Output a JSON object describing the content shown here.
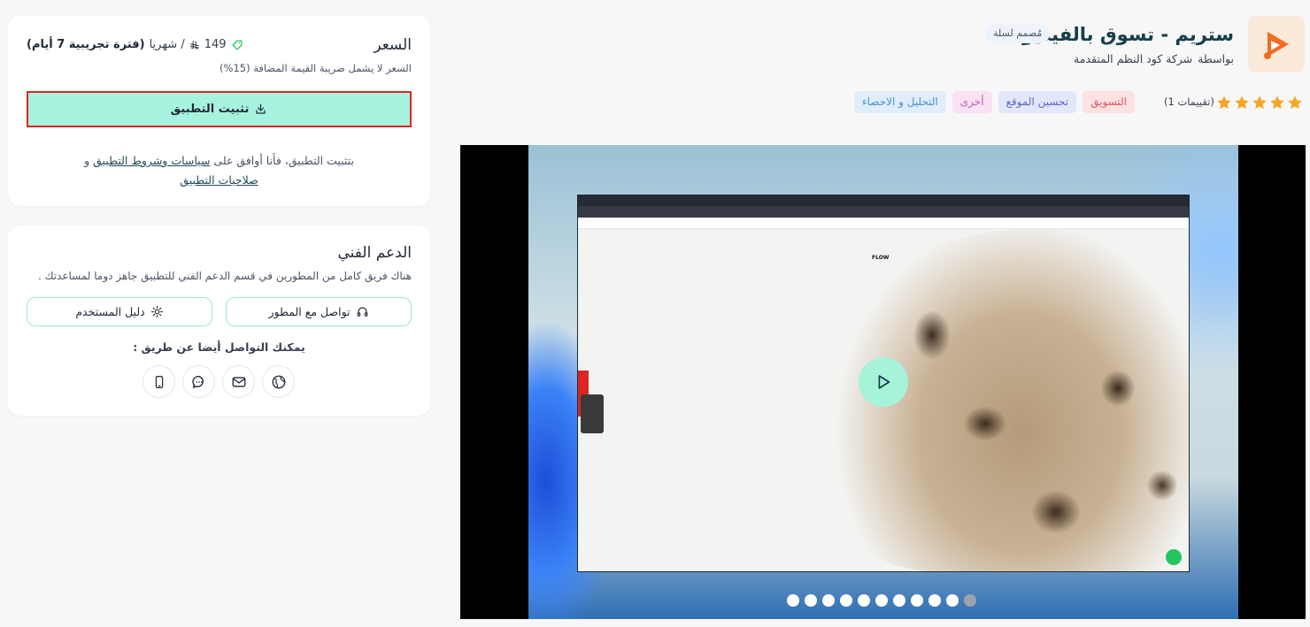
{
  "app": {
    "title": "ستريم - تسوق بالفيديو",
    "badge": "مُصمم لسلة",
    "by_label": "بواسطة",
    "developer": "شركة كود النظم المتقدمة",
    "rating_count": "(1 تقييمات)",
    "rating_stars": 5
  },
  "tags": [
    {
      "label": "التسويق",
      "bg": "#fde2e2",
      "fg": "#e0566a"
    },
    {
      "label": "تحسين الموقع",
      "bg": "#e3e7fa",
      "fg": "#5b64c9"
    },
    {
      "label": "أخرى",
      "bg": "#f8e2f4",
      "fg": "#c55cb6"
    },
    {
      "label": "التحليل و الاحصاء",
      "bg": "#e0eefb",
      "fg": "#4a8fd0"
    }
  ],
  "video": {
    "brand": "FLOW",
    "slide_count": 11,
    "active_slide": 11
  },
  "price": {
    "title": "السعر",
    "amount": "149",
    "per": "/ شهريا",
    "trial": "(فترة تجريبية 7 أيام)",
    "vat_note": "السعر لا يشمل ضريبة القيمة المضافة (15%)",
    "install_label": "تثبيت التطبيق",
    "terms_prefix": "بتثبيت التطبيق، فأنا أوافق على",
    "terms_link": "سياسات وشروط التطبيق",
    "terms_and": "و",
    "permissions_link": "صلاحيات التطبيق"
  },
  "support": {
    "title": "الدعم الفني",
    "description": "هناك فريق كامل من المطورين في قسم الدعم الفني للتطبيق جاهز دوما لمساعدتك .",
    "contact_dev_label": "تواصل مع المطور",
    "user_guide_label": "دليل المستخدم",
    "contact_also": "يمكنك التواصل أيضا عن طريق :"
  },
  "colors": {
    "accent": "#a7f3df",
    "star": "#f5a623",
    "title": "#163f4a"
  }
}
